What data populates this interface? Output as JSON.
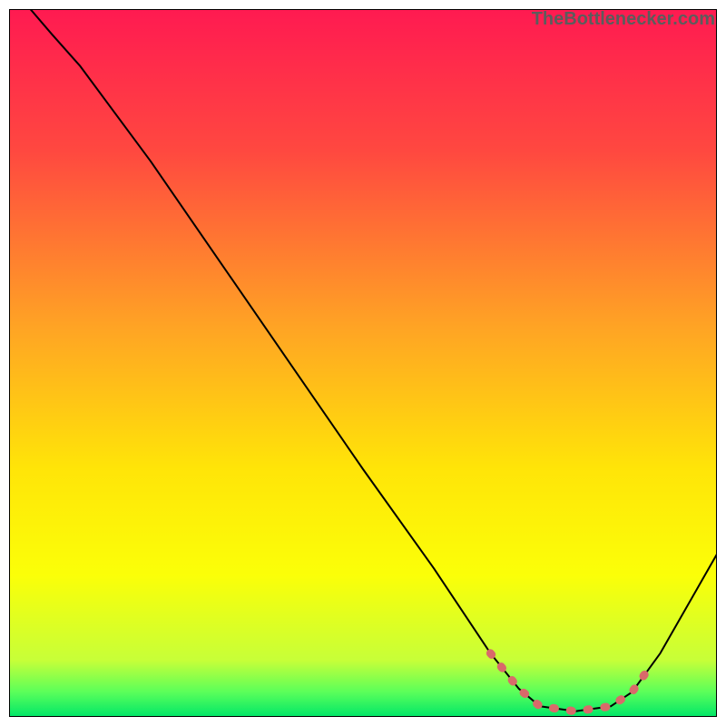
{
  "watermark": "TheBottlenecker.com",
  "chart_data": {
    "type": "line",
    "title": "",
    "xlabel": "",
    "ylabel": "",
    "x_range": [
      0,
      100
    ],
    "y_range": [
      0,
      100
    ],
    "gradient_stops": [
      {
        "offset": 0.0,
        "color": "#ff1a51"
      },
      {
        "offset": 0.2,
        "color": "#ff4840"
      },
      {
        "offset": 0.45,
        "color": "#ffa424"
      },
      {
        "offset": 0.65,
        "color": "#ffe508"
      },
      {
        "offset": 0.8,
        "color": "#fbff08"
      },
      {
        "offset": 0.92,
        "color": "#c7ff38"
      },
      {
        "offset": 0.965,
        "color": "#5aff5a"
      },
      {
        "offset": 1.0,
        "color": "#00e668"
      }
    ],
    "series": [
      {
        "name": "bottleneck-curve",
        "stroke": "#000000",
        "stroke_width": 2,
        "points": [
          {
            "x": 3.0,
            "y": 100.0
          },
          {
            "x": 6.0,
            "y": 96.5
          },
          {
            "x": 10.0,
            "y": 92.0
          },
          {
            "x": 20.0,
            "y": 78.5
          },
          {
            "x": 30.0,
            "y": 64.0
          },
          {
            "x": 40.0,
            "y": 49.5
          },
          {
            "x": 50.0,
            "y": 35.0
          },
          {
            "x": 60.0,
            "y": 21.0
          },
          {
            "x": 68.0,
            "y": 9.0
          },
          {
            "x": 72.0,
            "y": 4.0
          },
          {
            "x": 75.0,
            "y": 1.5
          },
          {
            "x": 80.0,
            "y": 0.8
          },
          {
            "x": 85.0,
            "y": 1.5
          },
          {
            "x": 88.0,
            "y": 3.5
          },
          {
            "x": 92.0,
            "y": 9.0
          },
          {
            "x": 100.0,
            "y": 23.0
          }
        ]
      },
      {
        "name": "optimal-zone-marker",
        "stroke": "#d96a6a",
        "stroke_width": 9,
        "dashed": true,
        "points": [
          {
            "x": 68.0,
            "y": 9.0
          },
          {
            "x": 72.0,
            "y": 4.0
          },
          {
            "x": 75.0,
            "y": 1.5
          },
          {
            "x": 80.0,
            "y": 0.8
          },
          {
            "x": 85.0,
            "y": 1.5
          },
          {
            "x": 88.0,
            "y": 3.5
          },
          {
            "x": 90.5,
            "y": 7.0
          }
        ]
      }
    ]
  }
}
